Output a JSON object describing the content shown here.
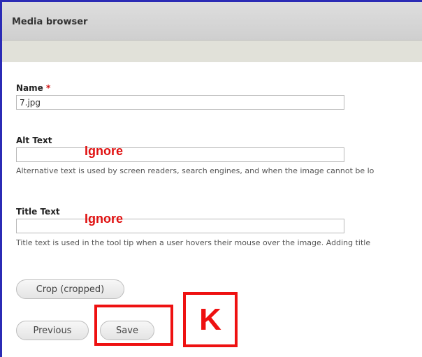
{
  "window": {
    "title": "Media browser"
  },
  "form": {
    "name": {
      "label": "Name",
      "required_mark": "*",
      "value": "7.jpg"
    },
    "alt_text": {
      "label": "Alt Text",
      "value": "",
      "description": "Alternative text is used by screen readers, search engines, and when the image cannot be lo"
    },
    "title_text": {
      "label": "Title Text",
      "value": "",
      "description": "Title text is used in the tool tip when a user hovers their mouse over the image. Adding title"
    }
  },
  "buttons": {
    "crop": "Crop (cropped)",
    "previous": "Previous",
    "save": "Save"
  },
  "annotations": {
    "ignore_alt": "Ignore",
    "ignore_title": "Ignore",
    "marker": "K",
    "color": "#ee1111"
  }
}
